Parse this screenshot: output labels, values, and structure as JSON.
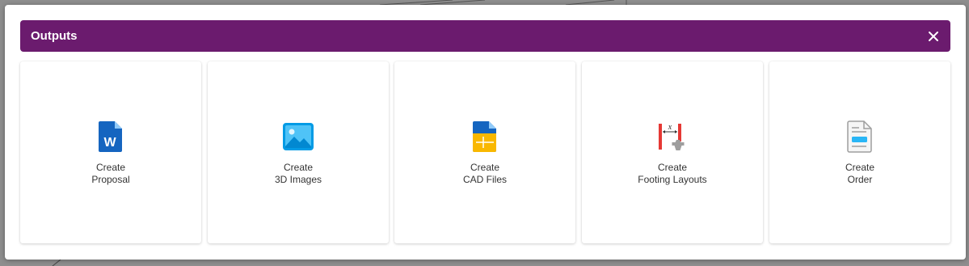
{
  "modal": {
    "title": "Outputs",
    "close_icon": "close-icon",
    "header_color": "#6b1b6e"
  },
  "cards": [
    {
      "line1": "Create",
      "line2": "Proposal",
      "icon": "word-document-icon"
    },
    {
      "line1": "Create",
      "line2": "3D Images",
      "icon": "image-icon"
    },
    {
      "line1": "Create",
      "line2": "CAD Files",
      "icon": "cad-file-icon"
    },
    {
      "line1": "Create",
      "line2": "Footing Layouts",
      "icon": "footing-layout-icon"
    },
    {
      "line1": "Create",
      "line2": "Order",
      "icon": "order-form-icon"
    }
  ]
}
